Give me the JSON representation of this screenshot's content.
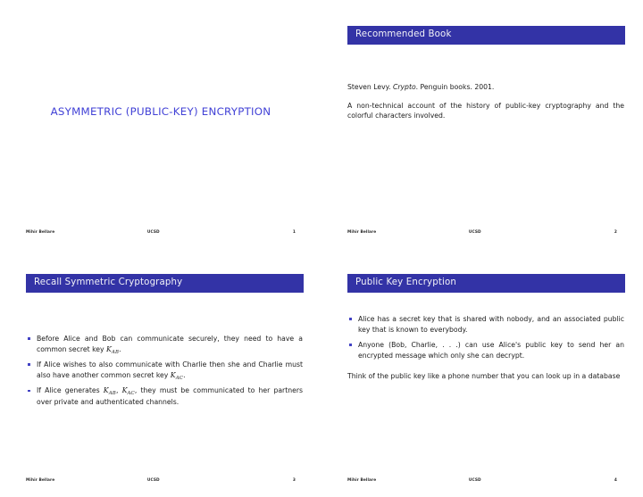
{
  "theme": {
    "bar_color": "#3333a6",
    "bar_text_color": "#f2f2f7",
    "title_color": "#4141d6",
    "bullet_color": "#4242c4",
    "body_color": "#1c1c1c",
    "page_background": "#ffffff"
  },
  "footer_common": {
    "author": "Mihir Bellare",
    "institution": "UCSD"
  },
  "slides": [
    {
      "id": "slide-1",
      "kind": "title",
      "doc_title": "ASYMMETRIC (PUBLIC-KEY) ENCRYPTION",
      "page_number": "1"
    },
    {
      "id": "slide-2",
      "kind": "content",
      "frame_title": "Recommended Book",
      "paragraphs": [
        {
          "pre": "Steven Levy. ",
          "italic": "Crypto",
          "post": ". Penguin books. 2001."
        },
        {
          "text": "A non-technical account of the history of public-key cryptography and the colorful characters involved."
        }
      ],
      "page_number": "2"
    },
    {
      "id": "slide-3",
      "kind": "content",
      "frame_title": "Recall Symmetric Cryptography",
      "bullets": [
        {
          "pre": "Before Alice and Bob can communicate securely, they need to have a common secret key ",
          "math": [
            {
              "sym": "K",
              "sub": "AB"
            }
          ],
          "post": "."
        },
        {
          "pre": "If Alice wishes to also communicate with Charlie then she and Charlie must also have another common secret key ",
          "math": [
            {
              "sym": "K",
              "sub": "AC"
            }
          ],
          "post": "."
        },
        {
          "pre": "If Alice generates ",
          "math": [
            {
              "sym": "K",
              "sub": "AB"
            },
            {
              "sym": "K",
              "sub": "AC"
            }
          ],
          "post": ", they must be communicated to her partners over private and authenticated channels."
        }
      ],
      "page_number": "3"
    },
    {
      "id": "slide-4",
      "kind": "content",
      "frame_title": "Public Key Encryption",
      "bullets": [
        {
          "text": "Alice has a secret key that is shared with nobody, and an associated public key that is known to everybody."
        },
        {
          "text": "Anyone (Bob, Charlie, . . .) can use Alice's public key to send her an encrypted message which only she can decrypt."
        }
      ],
      "trailing_paragraphs": [
        {
          "text": "Think of the public key like a phone number that you can look up in a database"
        }
      ],
      "page_number": "4"
    }
  ]
}
